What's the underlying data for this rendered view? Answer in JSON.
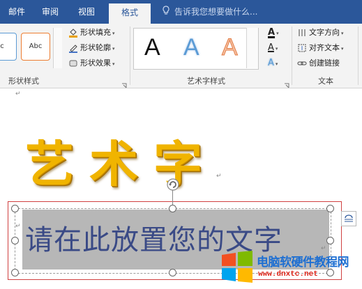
{
  "tabs": [
    {
      "label": "邮件",
      "active": false
    },
    {
      "label": "审阅",
      "active": false
    },
    {
      "label": "视图",
      "active": false
    },
    {
      "label": "格式",
      "active": true
    }
  ],
  "tell_me": {
    "placeholder": "告诉我您想要做什么...",
    "icon": "lightbulb-icon"
  },
  "ribbon": {
    "shape_styles": {
      "swatch_1": "c",
      "swatch_2": "Abc",
      "fill_label": "形状填充",
      "outline_label": "形状轮廓",
      "effects_label": "形状效果",
      "group_label": "形状样式"
    },
    "wordart_styles": {
      "gallery": [
        "A",
        "A",
        "A"
      ],
      "group_label": "艺术字样式",
      "text_fill_glyph": "A",
      "text_outline_glyph": "A",
      "text_effects_glyph": "A"
    },
    "text": {
      "direction_label": "文字方向",
      "align_label": "对齐文本",
      "link_label": "创建链接",
      "group_label": "文本"
    }
  },
  "document": {
    "paragraph_mark": "↵",
    "wordart_text": "艺术字",
    "textbox_text": "请在此放置您的文字",
    "textbox_paragraph_mark": "↵"
  },
  "watermark": {
    "title": "电脑软硬件教程网",
    "url": "www.dnxtc.net"
  },
  "colors": {
    "ribbon_tab_bg": "#2b579a",
    "wordart_fill": "#f0b400",
    "textbox_text": "#3a4a86",
    "selection_border": "#d04040"
  }
}
